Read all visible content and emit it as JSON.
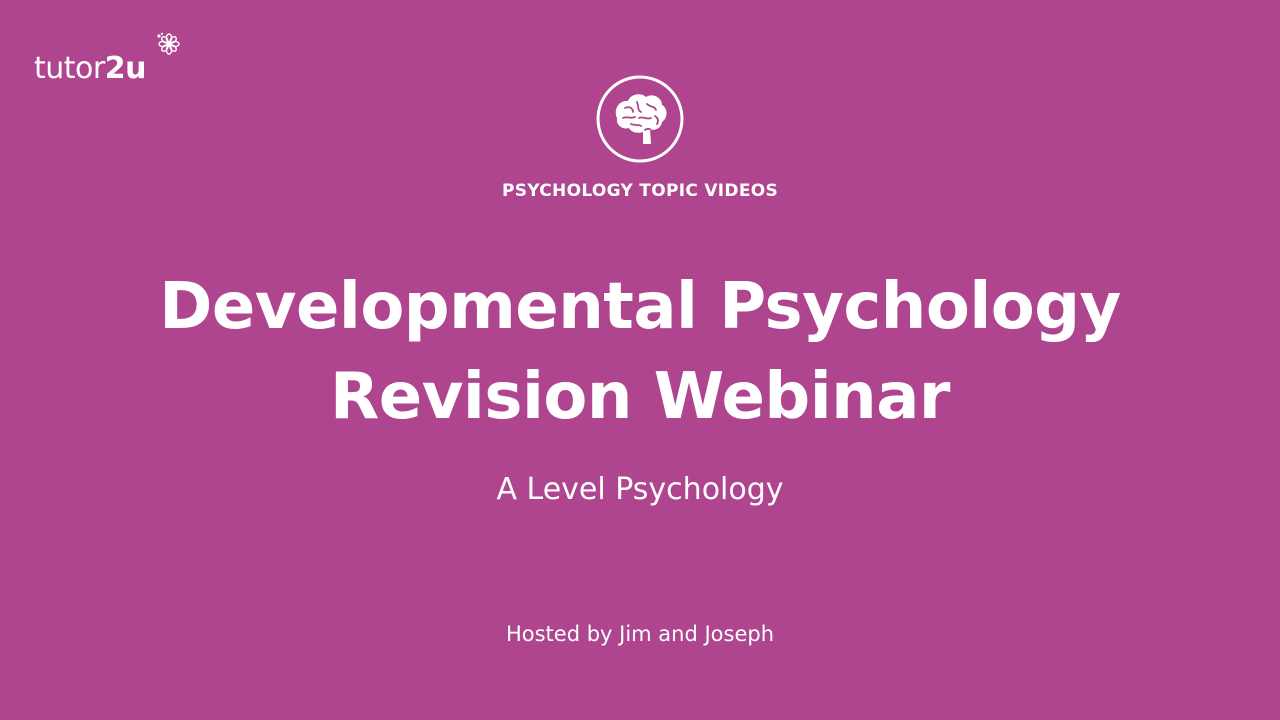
{
  "colors": {
    "background": "#ae458e",
    "foreground": "#ffffff"
  },
  "logo": {
    "text_regular": "tutor",
    "text_bold": "2u",
    "icon": "flower-icon"
  },
  "topic_icon": "brain-icon",
  "category": "PSYCHOLOGY TOPIC VIDEOS",
  "title": {
    "line1": "Developmental Psychology",
    "line2": "Revision Webinar"
  },
  "subtitle": "A Level Psychology",
  "host": "Hosted by Jim and Joseph"
}
